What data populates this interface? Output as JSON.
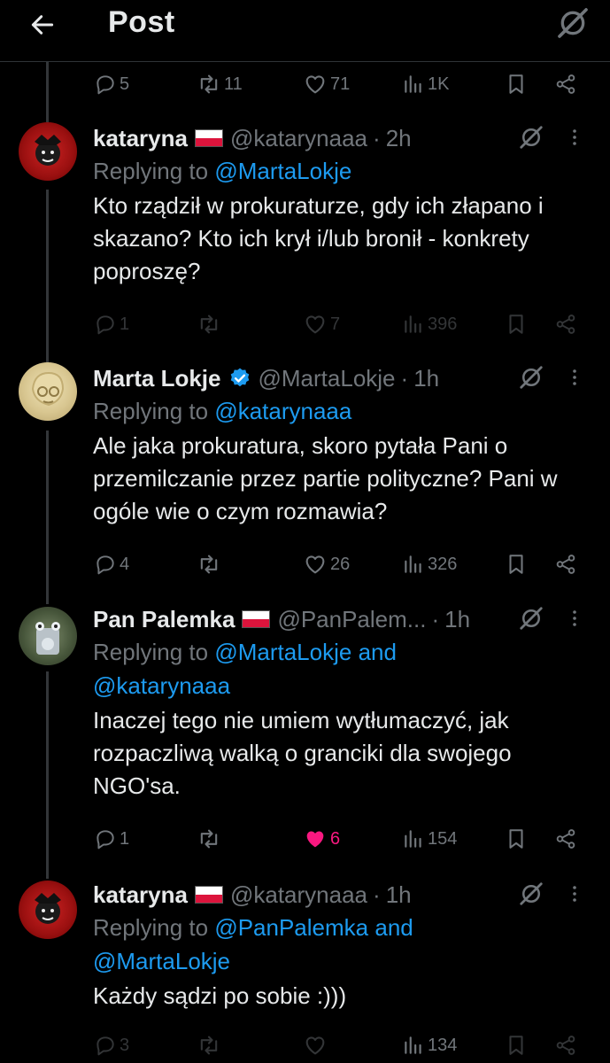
{
  "header": {
    "title": "Post",
    "back_icon": "arrow-left-icon",
    "grok_icon": "grok-icon"
  },
  "colors": {
    "background": "#000000",
    "text": "#e7e9ea",
    "muted": "#71767b",
    "link": "#1d9bf0",
    "like": "#f91880",
    "verified": "#1d9bf0"
  },
  "top_actions": {
    "replies": "5",
    "reposts": "11",
    "likes": "71",
    "views": "1K"
  },
  "tweets": [
    {
      "name": "kataryna",
      "handle": "@katarynaaa",
      "separator": "·",
      "time": "2h",
      "replying_prefix": "Replying to",
      "replying_to": "@MartaLokje",
      "replying_and": "",
      "replying_to2": "",
      "text": "Kto rządził w prokuraturze, gdy ich złapano i skazano? Kto ich krył i/lub bronił - konkrety poproszę?",
      "replies": "1",
      "reposts": "",
      "likes": "7",
      "views": "396"
    },
    {
      "name": "Marta Lokje",
      "handle": "@MartaLokje",
      "separator": "·",
      "time": "1h",
      "replying_prefix": "Replying to",
      "replying_to": "@katarynaaa",
      "replying_and": "",
      "replying_to2": "",
      "text": "Ale jaka prokuratura, skoro pytała Pani o przemilczanie przez partie polityczne? Pani w ogóle wie o czym rozmawia?",
      "replies": "4",
      "reposts": "",
      "likes": "26",
      "views": "326"
    },
    {
      "name": "Pan Palemka",
      "handle": "@PanPalem...",
      "separator": "·",
      "time": "1h",
      "replying_prefix": "Replying to",
      "replying_to": "@MartaLokje",
      "replying_and": "and",
      "replying_to2": "@katarynaaa",
      "text": "Inaczej tego nie umiem wytłumaczyć, jak rozpaczliwą walką o granciki dla swojego NGO'sa.",
      "replies": "1",
      "reposts": "",
      "likes": "6",
      "views": "154"
    },
    {
      "name": "kataryna",
      "handle": "@katarynaaa",
      "separator": "·",
      "time": "1h",
      "replying_prefix": "Replying to",
      "replying_to": "@PanPalemka",
      "replying_and": "and",
      "replying_to2": "@MartaLokje",
      "text": "Każdy sądzi po sobie :)))",
      "replies": "3",
      "reposts": "",
      "likes": "",
      "views": "134"
    }
  ]
}
